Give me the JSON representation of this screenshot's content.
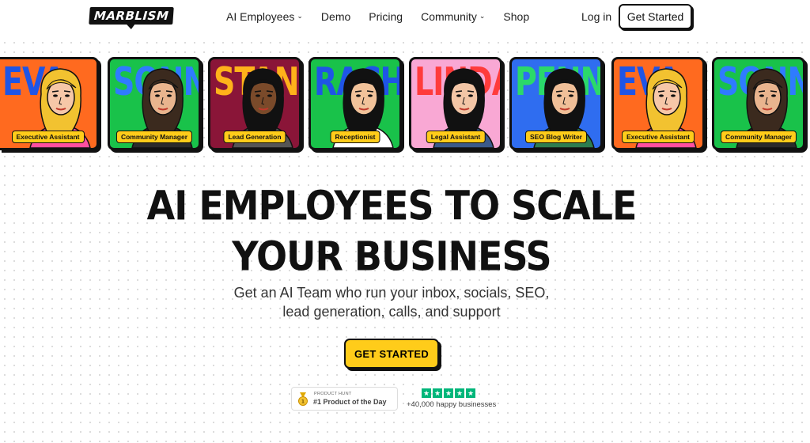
{
  "brand": {
    "logo_text": "MARBLISM"
  },
  "nav": {
    "items": [
      {
        "label": "AI Employees",
        "dropdown": true
      },
      {
        "label": "Demo",
        "dropdown": false
      },
      {
        "label": "Pricing",
        "dropdown": false
      },
      {
        "label": "Community",
        "dropdown": true
      },
      {
        "label": "Shop",
        "dropdown": false
      }
    ],
    "login_label": "Log in",
    "get_started_label": "Get Started"
  },
  "cards": [
    {
      "name": "EVA",
      "role": "Executive Assistant",
      "bg": "#ff6a1f",
      "name_color": "#1f55e6",
      "hair": "#f2c230",
      "skin": "#f6c7a8",
      "shirt": "#ff4fa0"
    },
    {
      "name": "SONNY",
      "role": "Community Manager",
      "bg": "#19c24a",
      "name_color": "#2f7bff",
      "hair": "#3b2a1e",
      "skin": "#e9b48e",
      "shirt": "#2b2b2b"
    },
    {
      "name": "STAN",
      "role": "Lead Generation",
      "bg": "#8a1538",
      "name_color": "#ffb21a",
      "hair": "#111111",
      "skin": "#7a4a2a",
      "shirt": "#555555"
    },
    {
      "name": "RACHEL",
      "role": "Receptionist",
      "bg": "#19c24a",
      "name_color": "#1f55e6",
      "hair": "#111111",
      "skin": "#f1c29a",
      "shirt": "#ffffff"
    },
    {
      "name": "LINDA",
      "role": "Legal Assistant",
      "bg": "#f9a8d4",
      "name_color": "#ff3b3b",
      "hair": "#111111",
      "skin": "#f3c6a6",
      "shirt": "#3b5a8a"
    },
    {
      "name": "PENNY",
      "role": "SEO Blog Writer",
      "bg": "#2f6df0",
      "name_color": "#2bd96a",
      "hair": "#111111",
      "skin": "#f0bf98",
      "shirt": "#2e7d4f"
    },
    {
      "name": "EVA",
      "role": "Executive Assistant",
      "bg": "#ff6a1f",
      "name_color": "#1f55e6",
      "hair": "#f2c230",
      "skin": "#f6c7a8",
      "shirt": "#ff4fa0"
    },
    {
      "name": "SONNY",
      "role": "Community Manager",
      "bg": "#19c24a",
      "name_color": "#2f7bff",
      "hair": "#3b2a1e",
      "skin": "#e9b48e",
      "shirt": "#2b2b2b"
    }
  ],
  "hero": {
    "headline_line1": "AI EMPLOYEES TO SCALE",
    "headline_line2": "YOUR BUSINESS",
    "subtitle_line1": "Get an AI Team who run your inbox, socials, SEO,",
    "subtitle_line2": "lead generation, calls, and support",
    "cta_label": "GET STARTED"
  },
  "social_proof": {
    "product_hunt_top": "PRODUCT HUNT",
    "product_hunt_main": "#1 Product of the Day",
    "stars": 5,
    "happy_text": "+40,000 happy businesses"
  },
  "colors": {
    "accent": "#ffcc1a",
    "trust_green": "#00b67a"
  }
}
